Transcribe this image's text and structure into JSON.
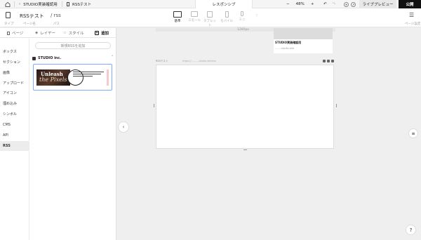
{
  "topbar": {
    "breadcrumb_project": "STUDIO実装確認用",
    "breadcrumb_page": "RSSテスト",
    "responsive_tab": "レスポンシブ",
    "zoom_value": "48%",
    "zoom_minus": "−",
    "zoom_plus": "+",
    "live_preview": "ライブプレビュー",
    "publish": "公開"
  },
  "pagebar": {
    "type_label": "タイプ",
    "page_name": "RSSテスト",
    "page_name_label": "ページ名",
    "path": "/ rss",
    "path_label": "パス",
    "devices": [
      {
        "label": "基準"
      },
      {
        "label": "スモール"
      },
      {
        "label": "タブレット"
      },
      {
        "label": "モバイル"
      },
      {
        "label": "ミニ"
      }
    ],
    "settings_label": "ページ設定"
  },
  "panel": {
    "tabs": [
      {
        "label": "ページ"
      },
      {
        "label": "レイヤー"
      },
      {
        "label": "スタイル"
      },
      {
        "label": "追加"
      }
    ],
    "categories": [
      {
        "label": "ボックス"
      },
      {
        "label": "セクション"
      },
      {
        "label": "画像"
      },
      {
        "label": "アップロード"
      },
      {
        "label": "アイコン"
      },
      {
        "label": "埋め込み"
      },
      {
        "label": "シンボル"
      },
      {
        "label": "CMS"
      },
      {
        "label": "API"
      },
      {
        "label": "RSS"
      }
    ],
    "add_rss": "新規RSSを追加",
    "rss_source": "STUDIO inc.",
    "thumb_title1": "Unleash",
    "thumb_title2": "the Pixels"
  },
  "canvas": {
    "width_label": "1280px",
    "mini_title": "STUDIO実装確認用",
    "mini_sub": "........studio.site",
    "frame_label": "RSSテスト",
    "frame_url": "https://..........studio.site/rss"
  }
}
